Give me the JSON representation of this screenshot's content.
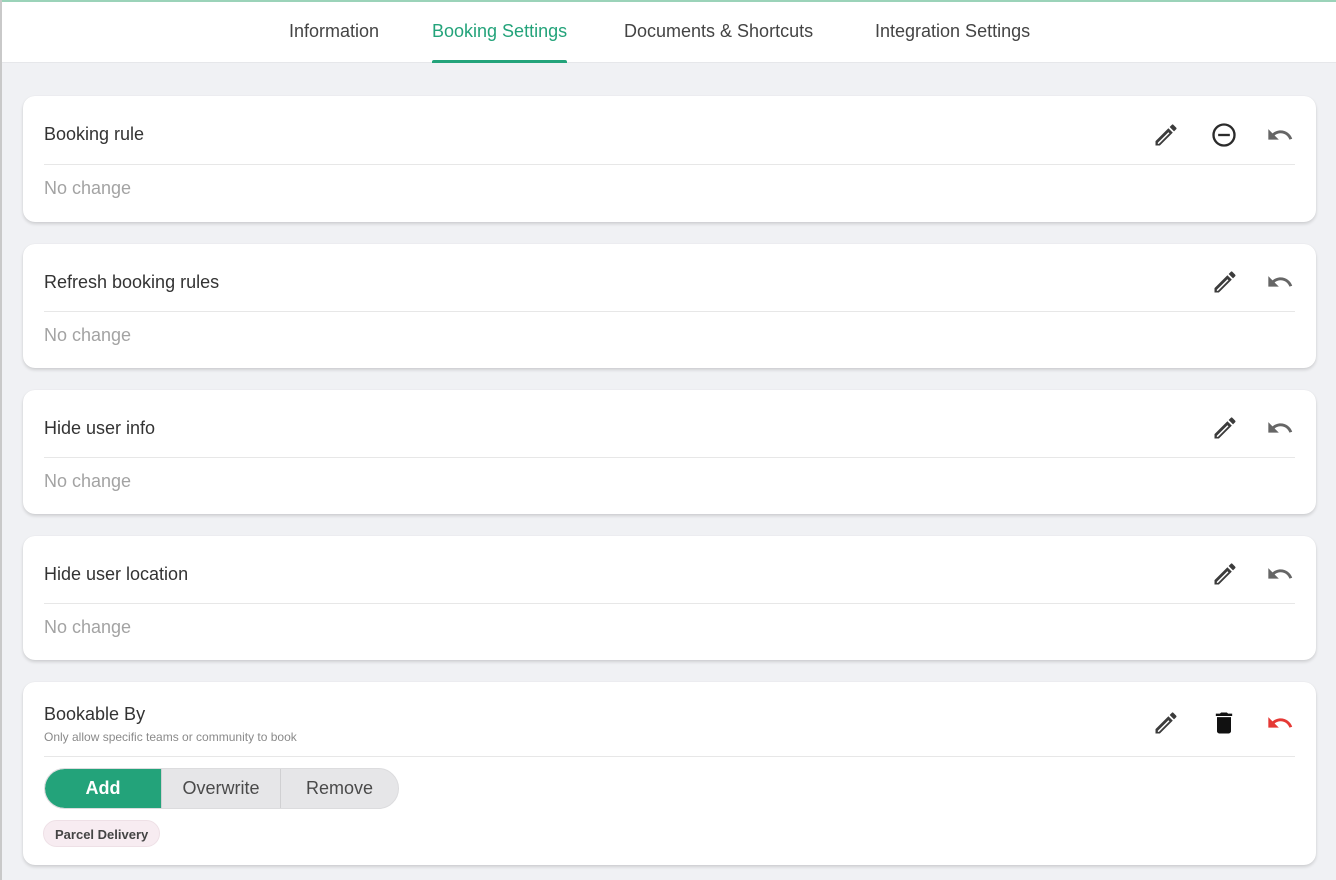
{
  "tabs": [
    {
      "label": "Information"
    },
    {
      "label": "Booking Settings"
    },
    {
      "label": "Documents & Shortcuts"
    },
    {
      "label": "Integration Settings"
    }
  ],
  "active_tab": "Booking Settings",
  "cards": [
    {
      "title": "Booking rule",
      "value": "No change",
      "actions": [
        "pencil-icon",
        "remove-circle-icon",
        "undo-icon"
      ]
    },
    {
      "title": "Refresh booking rules",
      "value": "No change",
      "actions": [
        "pencil-icon",
        "undo-icon"
      ]
    },
    {
      "title": "Hide user info",
      "value": "No change",
      "actions": [
        "pencil-icon",
        "undo-icon"
      ]
    },
    {
      "title": "Hide user location",
      "value": "No change",
      "actions": [
        "pencil-icon",
        "undo-icon"
      ]
    }
  ],
  "bookable_by": {
    "title": "Bookable By",
    "subtitle": "Only allow specific teams or community to book",
    "modes": [
      "Add",
      "Overwrite",
      "Remove"
    ],
    "selected_mode": "Add",
    "chips": [
      "Parcel Delivery"
    ],
    "actions": [
      "pencil-icon",
      "trash-icon",
      "undo-icon"
    ]
  },
  "colors": {
    "accent": "#23a37a",
    "undo_active": "#e53935",
    "background": "#f0f1f4"
  }
}
